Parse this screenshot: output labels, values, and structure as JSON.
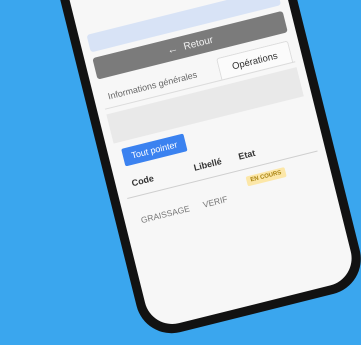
{
  "back_button": {
    "label": "Retour",
    "icon": "arrow-left-icon"
  },
  "tabs": [
    {
      "label": "Informations générales"
    },
    {
      "label": "Opérations",
      "active": true
    }
  ],
  "actions": {
    "point_all_label": "Tout pointer"
  },
  "table": {
    "headers": {
      "code": "Code",
      "libelle": "Libellé",
      "etat": "Etat"
    },
    "rows": [
      {
        "code": "GRAISSAGE",
        "libelle": "VERIF",
        "etat": "EN COURS"
      }
    ]
  },
  "colors": {
    "background": "#3aa6ee",
    "primary_button": "#3b82f0",
    "back_button": "#7b7b7b",
    "status_badge_bg": "#fce7a8",
    "status_badge_text": "#a8820f"
  }
}
